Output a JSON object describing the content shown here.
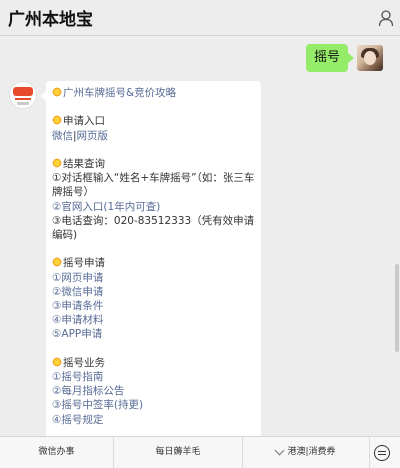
{
  "header": {
    "title": "广州本地宝"
  },
  "chat": {
    "outgoing": {
      "text": "摇号"
    },
    "incoming": {
      "title": "广州车牌摇号&竞价攻略",
      "apply_entry": {
        "heading": "申请入口",
        "link1": "微信",
        "sep": "|",
        "link2": "网页版"
      },
      "result_query": {
        "heading": "结果查询",
        "item1": "①对话框输入“姓名+车牌摇号”（如：张三车牌摇号）",
        "item2": "②官网入口(1年内可查)",
        "item3": "③电话查询：020-83512333（凭有效申请编码)"
      },
      "lottery_apply": {
        "heading": "摇号申请",
        "items": [
          "①网页申请",
          "②微信申请",
          "③申请条件",
          "④申请材料",
          "⑤APP申请"
        ]
      },
      "lottery_business": {
        "heading": "摇号业务",
        "items": [
          "①摇号指南",
          "②每月指标公告",
          "③摇号中签率(持更)",
          "④摇号规定"
        ]
      }
    }
  },
  "bottom_menu": {
    "items": [
      "微信办事",
      "每日薅羊毛",
      "港澳|消费券"
    ]
  }
}
